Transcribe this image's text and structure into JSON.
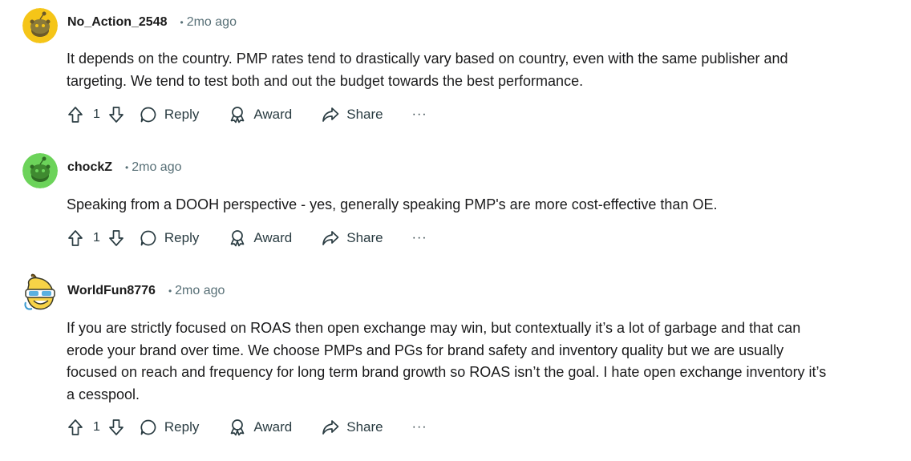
{
  "comments": [
    {
      "username": "No_Action_2548",
      "separator": "•",
      "time": "2mo ago",
      "avatar_color": "#f5c518",
      "avatar_icon": "snoo-avatar-icon",
      "body": "It depends on the country. PMP rates tend to drastically vary based on country, even with the same publisher and targeting. We tend to test both and out the budget towards the best performance.",
      "votes": "1",
      "reply_label": "Reply",
      "award_label": "Award",
      "share_label": "Share",
      "more_label": "···"
    },
    {
      "username": "chockZ",
      "separator": "•",
      "time": "2mo ago",
      "avatar_color": "#6cd35a",
      "avatar_icon": "snoo-avatar-icon",
      "body": "Speaking from a DOOH perspective - yes, generally speaking PMP's are more cost-effective than OE.",
      "votes": "1",
      "reply_label": "Reply",
      "award_label": "Award",
      "share_label": "Share",
      "more_label": "···"
    },
    {
      "username": "WorldFun8776",
      "separator": "•",
      "time": "2mo ago",
      "avatar_color": "#f7d347",
      "avatar_icon": "banana-avatar-icon",
      "body": "If you are strictly focused on ROAS then open exchange may win, but contextually it’s a lot of garbage and that can erode your brand over time. We choose PMPs and PGs for brand safety and inventory quality but we are usually focused on reach and frequency for long term brand growth so ROAS isn’t the goal. I hate open exchange inventory it’s a cesspool.",
      "votes": "1",
      "reply_label": "Reply",
      "award_label": "Award",
      "share_label": "Share",
      "more_label": "···"
    }
  ]
}
